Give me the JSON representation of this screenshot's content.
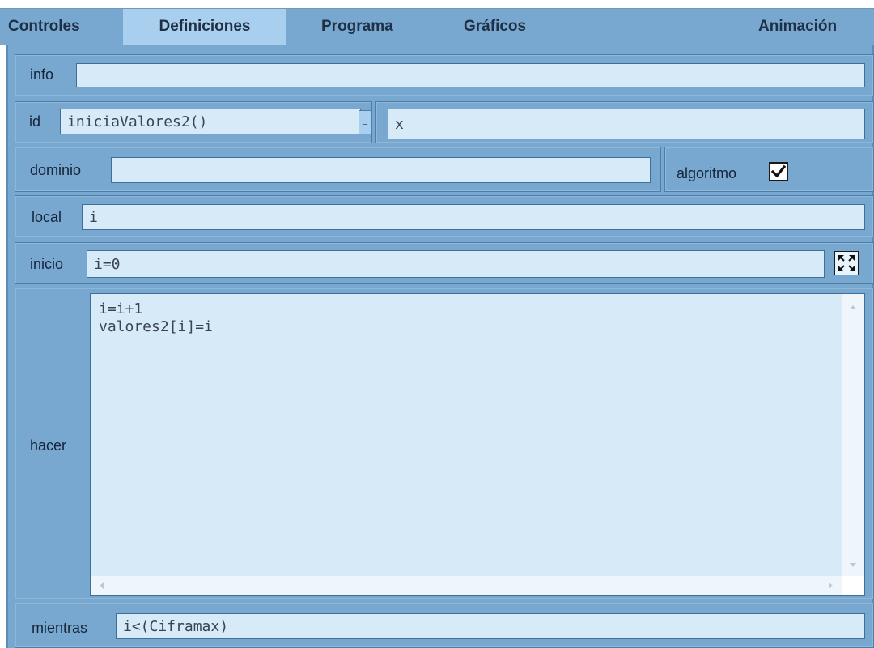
{
  "tabs": [
    {
      "label": "Controles"
    },
    {
      "label": "Definiciones"
    },
    {
      "label": "Programa"
    },
    {
      "label": "Gráficos"
    },
    {
      "label": "Animación"
    }
  ],
  "active_tab": "Definiciones",
  "form": {
    "info": {
      "label": "info",
      "value": ""
    },
    "id": {
      "label": "id",
      "value": "iniciaValores2()",
      "equals": "=",
      "expression": "x"
    },
    "dominio": {
      "label": "dominio",
      "value": ""
    },
    "algoritmo": {
      "label": "algoritmo",
      "checked": true
    },
    "local": {
      "label": "local",
      "value": "i"
    },
    "inicio": {
      "label": "inicio",
      "value": "i=0"
    },
    "hacer": {
      "label": "hacer",
      "lines": [
        "i=i+1",
        "valores2[i]=i"
      ]
    },
    "mientras": {
      "label": "mientras",
      "value": "i<(Ciframax)"
    }
  },
  "icons": {
    "expand": "expand-icon",
    "check": "check-icon",
    "scroll_up": "scroll-up-arrow-icon",
    "scroll_down": "scroll-down-arrow-icon",
    "scroll_left": "scroll-left-arrow-icon",
    "scroll_right": "scroll-right-arrow-icon"
  },
  "colors": {
    "panel": "#78a8cf",
    "active_tab": "#a8d0ee",
    "field": "#d6eaf8"
  }
}
